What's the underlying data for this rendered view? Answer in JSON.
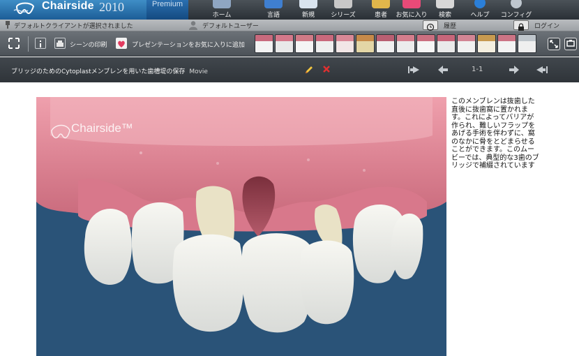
{
  "app": {
    "brand_name": "Chairside",
    "brand_year": "2010",
    "edition": "Premium"
  },
  "nav": {
    "items": [
      {
        "label": "ホーム",
        "icon": "home-icon",
        "color": "#8fa6c2"
      },
      {
        "label": "言語",
        "icon": "language-icon",
        "color": "#3f7fd0"
      },
      {
        "label": "新規",
        "icon": "new-icon",
        "color": "#d9e4ef"
      },
      {
        "label": "シリーズ",
        "icon": "series-icon",
        "color": "#c8c8c8"
      },
      {
        "label": "患者",
        "icon": "patient-icon",
        "color": "#e0b64b"
      },
      {
        "label": "お気に入り",
        "icon": "favorites-icon",
        "color": "#e84a78"
      },
      {
        "label": "検索",
        "icon": "search-icon",
        "color": "#d8d8d8"
      },
      {
        "label": "ヘルプ",
        "icon": "help-icon",
        "color": "#2b7fd8"
      },
      {
        "label": "コンフィグ",
        "icon": "config-icon",
        "color": "#bfc7cf"
      }
    ]
  },
  "status": {
    "client": "デフォルトクライアントが選択されました",
    "user": "デフォルトユーザー",
    "history": "履歴",
    "login": "ログイン"
  },
  "toolbar": {
    "print_scene": "シーンの印刷",
    "add_favorite": "プレゼンテーションをお気に入りに追加",
    "thumbnail_count": 14
  },
  "movie": {
    "title": "ブリッジのためのCytoplastメンブレンを用いた歯槽堤の保存",
    "type": "Movie",
    "page": "1-1"
  },
  "scene": {
    "watermark": "Chairside™"
  },
  "description": "このメンブレンは抜歯した直後に抜歯窩に置かれます。これによってバリアが作られ、難しいフラップをあげる手術を伴わずに、窩のなかに骨をとどまらせることができます。このムービーでは、典型的な3歯のブリッジで補綴されています",
  "colors": {
    "accent_blue": "#1c5d97",
    "background_dark": "#2f3439",
    "scene_bg": "#2a5378",
    "delete_red": "#e03030",
    "edit_yellow": "#f2c640"
  }
}
